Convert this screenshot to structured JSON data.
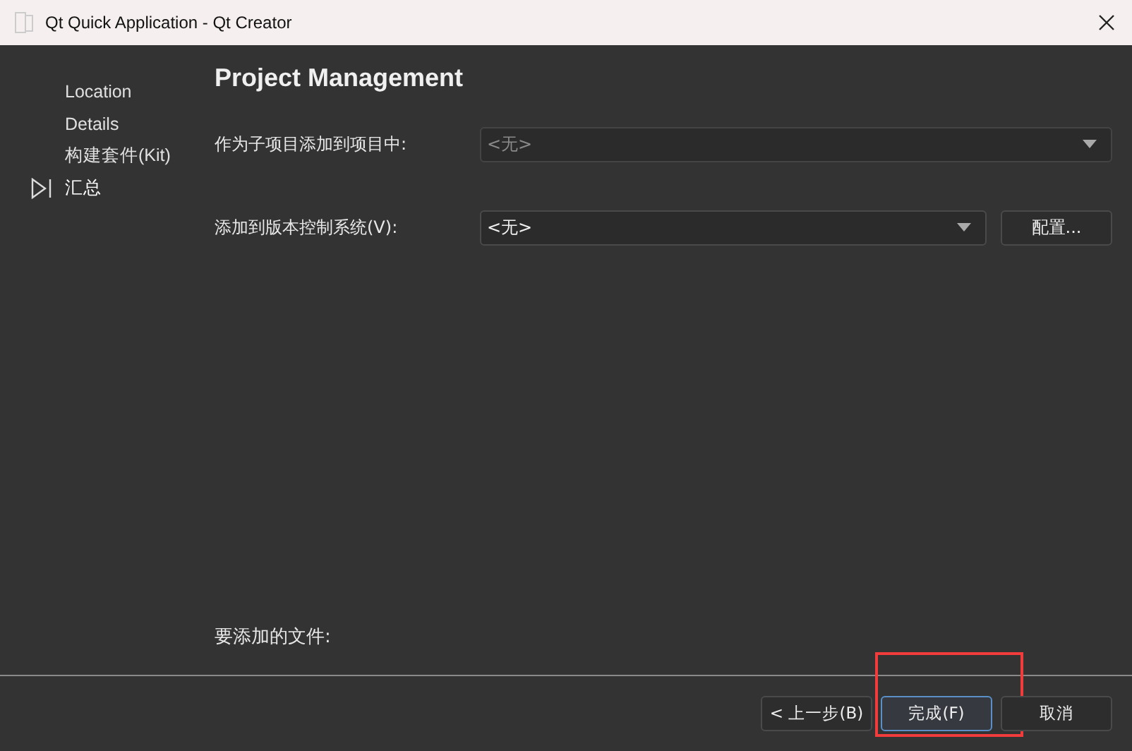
{
  "window": {
    "title": "Qt Quick Application - Qt Creator"
  },
  "sidebar": {
    "items": [
      {
        "label": "Location",
        "selected": false
      },
      {
        "label": "Details",
        "selected": false
      },
      {
        "label": "构建套件(Kit)",
        "selected": false
      },
      {
        "label": "汇总",
        "selected": true
      }
    ]
  },
  "page": {
    "title": "Project Management",
    "fields": [
      {
        "label": "作为子项目添加到项目中:",
        "value": "<无>",
        "disabled": true
      },
      {
        "label": "添加到版本控制系统(V):",
        "value": "<无>",
        "disabled": false,
        "button": "配置..."
      }
    ],
    "files_label": "要添加的文件:"
  },
  "buttons": [
    {
      "label": "< 上一步(B)",
      "default": false,
      "highlighted": false
    },
    {
      "label": "完成(F)",
      "default": true,
      "highlighted": true
    },
    {
      "label": "取消",
      "default": false,
      "highlighted": false
    }
  ]
}
